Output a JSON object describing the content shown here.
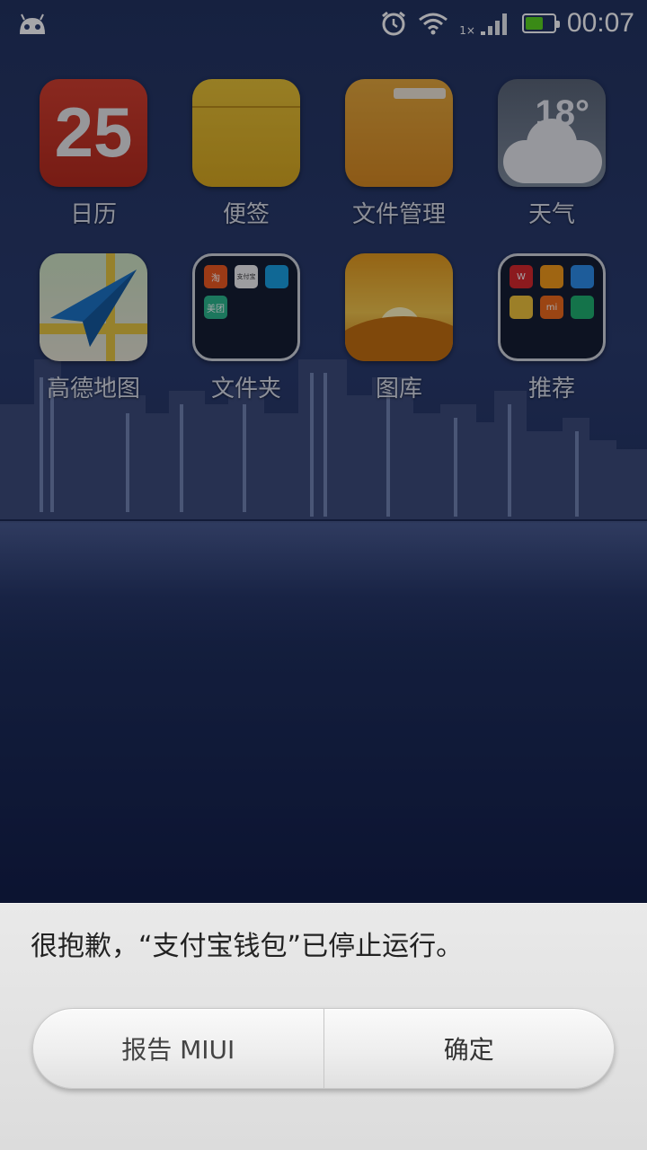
{
  "status_bar": {
    "time": "00:07",
    "network_label": "1×",
    "battery_level": 0.62,
    "icons": [
      "android-icon",
      "alarm-icon",
      "wifi-icon",
      "signal-icon",
      "battery-icon"
    ]
  },
  "apps": [
    {
      "label": "日历",
      "icon": "calendar-icon",
      "badge_text": "25"
    },
    {
      "label": "便签",
      "icon": "notes-icon"
    },
    {
      "label": "文件管理",
      "icon": "file-manager-icon"
    },
    {
      "label": "天气",
      "icon": "weather-icon",
      "temp_text": "18°"
    },
    {
      "label": "高德地图",
      "icon": "amap-icon"
    },
    {
      "label": "文件夹",
      "icon": "folder-icon",
      "mini_labels": [
        "淘",
        "支付宝",
        "",
        "美团"
      ]
    },
    {
      "label": "图库",
      "icon": "gallery-icon"
    },
    {
      "label": "推荐",
      "icon": "recommend-folder-icon",
      "mini_labels": [
        "W",
        "",
        "",
        "",
        "mi",
        ""
      ]
    }
  ],
  "dialog": {
    "message": "很抱歉，“支付宝钱包”已停止运行。",
    "report_button": "报告 MIUI",
    "ok_button": "确定"
  },
  "colors": {
    "dialog_bg": "#e2e2e2",
    "battery_fill": "#5ad41e",
    "calendar_red": "#c8341f",
    "notes_yellow": "#e2b628"
  }
}
